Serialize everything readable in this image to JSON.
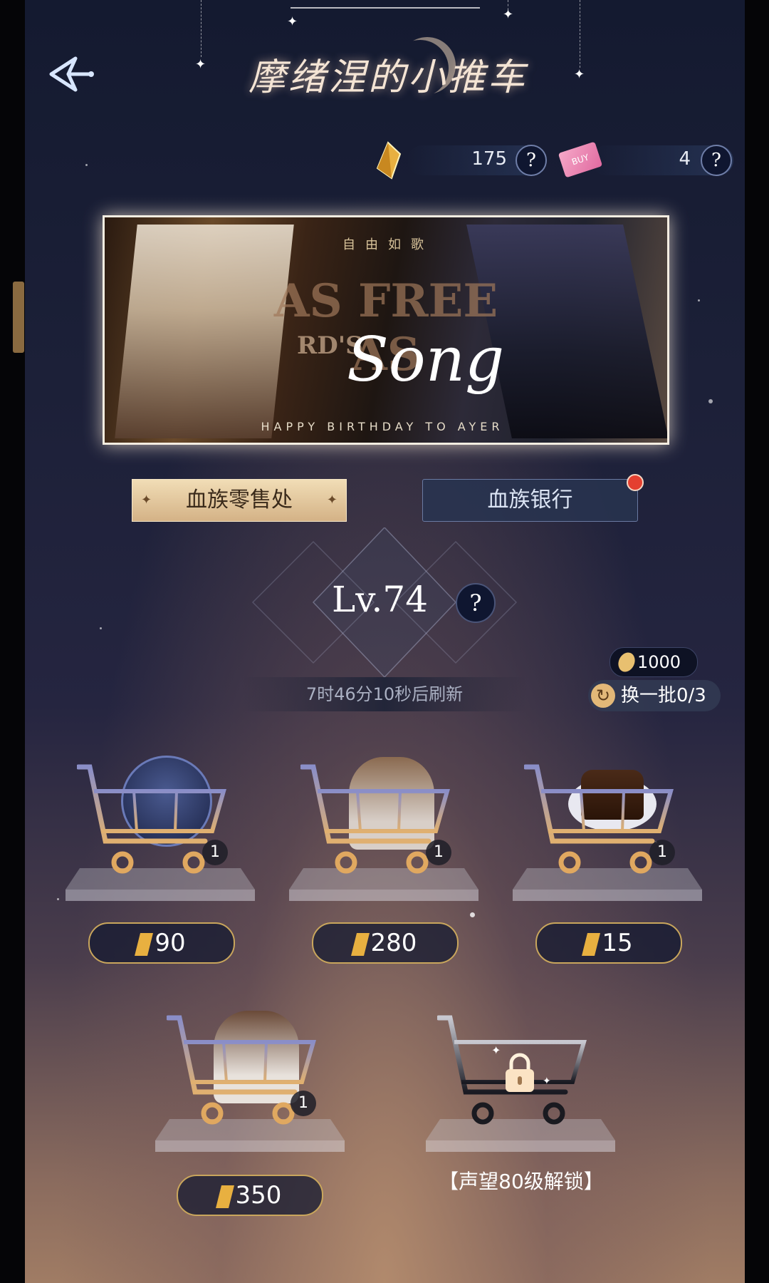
{
  "title": "摩绪涅的小推车",
  "currency": [
    {
      "name": "gold-crystal-icon",
      "value": "175"
    },
    {
      "name": "ticket-icon",
      "value": "4"
    }
  ],
  "help_label": "?",
  "banner": {
    "heading": "自由如歌",
    "big_text": "AS FREE AS",
    "small_text": "RD'S",
    "script_text": "Song",
    "caption": "HAPPY BIRTHDAY TO AYER"
  },
  "tabs": {
    "retail": "血族零售处",
    "bank": "血族银行"
  },
  "level": "Lv.74",
  "refresh_text": "7时46分10秒后刷新",
  "coin_balance": "1000",
  "swap_label": "换一批0/3",
  "shop_items": [
    {
      "price": "90",
      "qty": "1",
      "image": "chibi-avatar"
    },
    {
      "price": "280",
      "qty": "1",
      "image": "character-portrait"
    },
    {
      "price": "15",
      "qty": "1",
      "image": "chocolate-cake"
    },
    {
      "price": "350",
      "qty": "1",
      "image": "character-portrait"
    }
  ],
  "locked_label": "【声望80级解锁】",
  "colors": {
    "accent_gold": "#c9a65c",
    "badge_red": "#e44030"
  }
}
